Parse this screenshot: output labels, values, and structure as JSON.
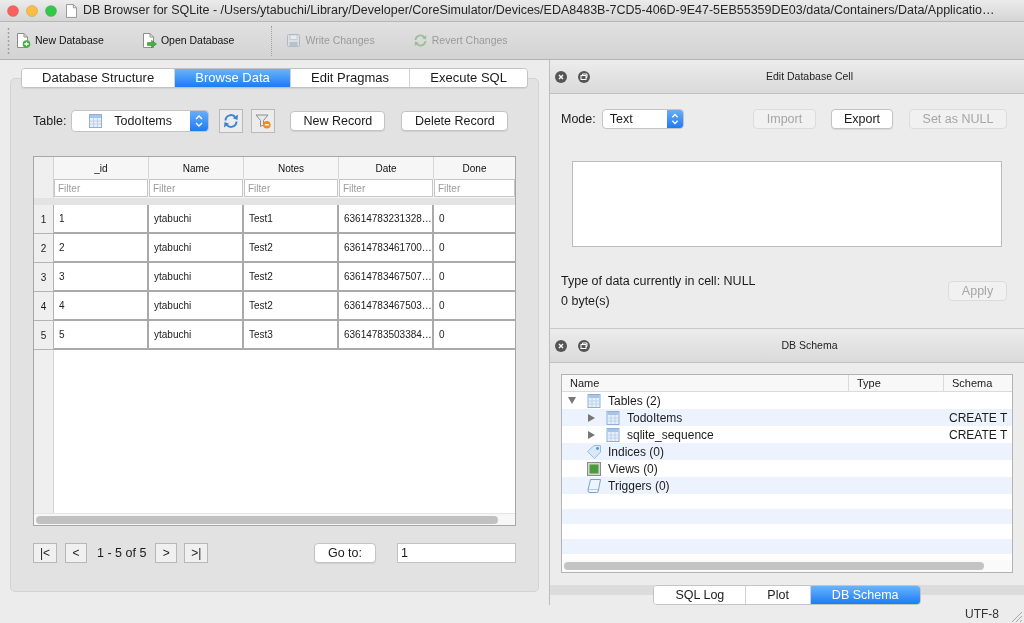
{
  "window": {
    "title": "DB Browser for SQLite - /Users/ytabuchi/Library/Developer/CoreSimulator/Devices/EDA8483B-7CD5-406D-9E47-5EB55359DE03/data/Containers/Data/Applicatio…"
  },
  "toolbar": [
    {
      "label": "New Database",
      "kind": "new",
      "disabled": false
    },
    {
      "label": "Open Database",
      "kind": "open",
      "disabled": false
    },
    {
      "label": "Write Changes",
      "kind": "write",
      "disabled": true
    },
    {
      "label": "Revert Changes",
      "kind": "revert",
      "disabled": true
    }
  ],
  "main_tabs": [
    {
      "label": "Database Structure",
      "selected": false
    },
    {
      "label": "Browse Data",
      "selected": true
    },
    {
      "label": "Edit Pragmas",
      "selected": false
    },
    {
      "label": "Execute SQL",
      "selected": false
    }
  ],
  "browse_data": {
    "table_label": "Table:",
    "table_value": "TodoItems",
    "actions": [
      "New Record",
      "Delete Record"
    ],
    "grid": {
      "columns": [
        {
          "label": "_id",
          "filter_placeholder": "Filter"
        },
        {
          "label": "Name",
          "filter_placeholder": "Filter"
        },
        {
          "label": "Notes",
          "filter_placeholder": "Filter"
        },
        {
          "label": "Date",
          "filter_placeholder": "Filter"
        },
        {
          "label": "Done",
          "filter_placeholder": "Filter"
        }
      ],
      "rows": [
        {
          "header": "1",
          "cells": [
            "1",
            "ytabuchi",
            "Test1",
            "63614783231328…",
            "0"
          ]
        },
        {
          "header": "2",
          "cells": [
            "2",
            "ytabuchi",
            "Test2",
            "63614783461700…",
            "0"
          ]
        },
        {
          "header": "3",
          "cells": [
            "3",
            "ytabuchi",
            "Test2",
            "63614783467507…",
            "0"
          ]
        },
        {
          "header": "4",
          "cells": [
            "4",
            "ytabuchi",
            "Test2",
            "63614783467503…",
            "0"
          ]
        },
        {
          "header": "5",
          "cells": [
            "5",
            "ytabuchi",
            "Test3",
            "63614783503384…",
            "0"
          ]
        }
      ]
    },
    "pagination": {
      "first": "|<",
      "previous": "<",
      "range": "1 - 5 of 5",
      "next": ">",
      "last": ">|",
      "goto_button": "Go to:",
      "goto_value": "1"
    }
  },
  "edit_cell_dock": {
    "title": "Edit Database Cell",
    "mode_label": "Mode:",
    "mode_value": "Text",
    "buttons": [
      {
        "label": "Import",
        "disabled": true
      },
      {
        "label": "Export",
        "disabled": false
      },
      {
        "label": "Set as NULL",
        "disabled": true
      }
    ],
    "type_info": "Type of data currently in cell: NULL",
    "size_info": "0 byte(s)",
    "apply": {
      "label": "Apply",
      "disabled": true
    }
  },
  "schema_dock": {
    "title": "DB Schema",
    "columns": [
      "Name",
      "Type",
      "Schema"
    ],
    "tree": [
      {
        "label": "Tables (2)",
        "kind": "tables",
        "expanded": true,
        "children": [
          {
            "label": "TodoItems",
            "kind": "table",
            "expanded": false,
            "schema": "CREATE T"
          },
          {
            "label": "sqlite_sequence",
            "kind": "table",
            "expanded": false,
            "schema": "CREATE T"
          }
        ]
      },
      {
        "label": "Indices (0)",
        "kind": "indices"
      },
      {
        "label": "Views (0)",
        "kind": "views"
      },
      {
        "label": "Triggers (0)",
        "kind": "triggers"
      }
    ]
  },
  "dock_tabs": [
    {
      "label": "SQL Log",
      "selected": false
    },
    {
      "label": "Plot",
      "selected": false
    },
    {
      "label": "DB Schema",
      "selected": true
    }
  ],
  "status_bar": {
    "encoding": "UTF-8"
  }
}
